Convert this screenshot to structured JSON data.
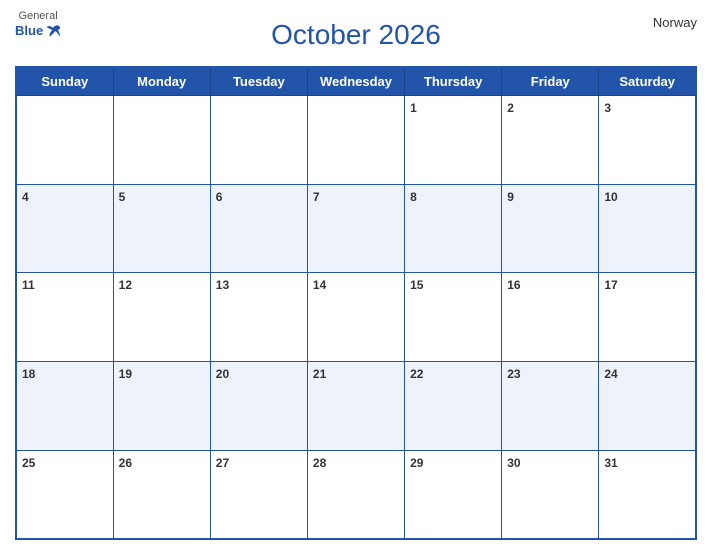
{
  "header": {
    "title": "October 2026",
    "country": "Norway",
    "logo_general": "General",
    "logo_blue": "Blue"
  },
  "days_of_week": [
    "Sunday",
    "Monday",
    "Tuesday",
    "Wednesday",
    "Thursday",
    "Friday",
    "Saturday"
  ],
  "weeks": [
    [
      null,
      null,
      null,
      null,
      1,
      2,
      3
    ],
    [
      4,
      5,
      6,
      7,
      8,
      9,
      10
    ],
    [
      11,
      12,
      13,
      14,
      15,
      16,
      17
    ],
    [
      18,
      19,
      20,
      21,
      22,
      23,
      24
    ],
    [
      25,
      26,
      27,
      28,
      29,
      30,
      31
    ]
  ]
}
